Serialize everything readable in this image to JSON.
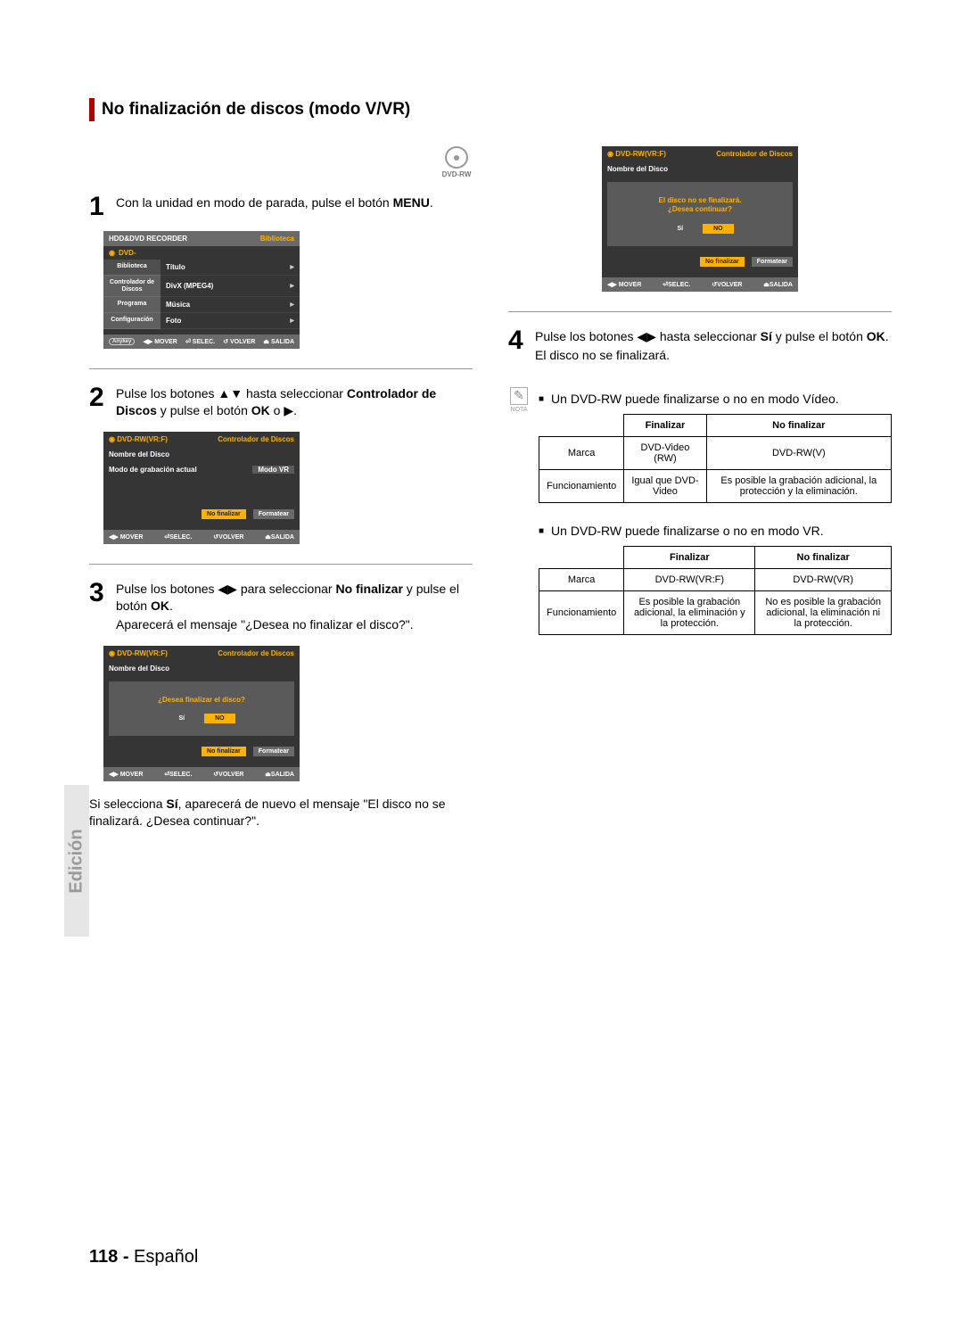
{
  "title": "No finalización de discos (modo V/VR)",
  "disc_label": "DVD-RW",
  "steps": {
    "s1": {
      "num": "1",
      "text_a": "Con la unidad en modo de parada, pulse el botón ",
      "b": "MENU",
      "text_b": "."
    },
    "s2": {
      "num": "2",
      "text_a": "Pulse los botones ▲▼ hasta seleccionar ",
      "b": "Controlador de Discos",
      "text_b": " y pulse el botón ",
      "b2": "OK",
      "text_c": " o ▶."
    },
    "s3": {
      "num": "3",
      "text_a": "Pulse los botones ◀▶ para seleccionar ",
      "b": "No finalizar",
      "text_b": " y pulse el botón ",
      "b2": "OK",
      "text_c": ".",
      "follow": "Aparecerá el mensaje \"¿Desea no finalizar el disco?\"."
    },
    "s3b": {
      "pre": "Si selecciona ",
      "b": "Sí",
      "post": ", aparecerá de nuevo el mensaje \"El disco no se finalizará. ¿Desea continuar?\"."
    },
    "s4": {
      "num": "4",
      "text_a": "Pulse los botones ◀▶ hasta seleccionar ",
      "b": "Sí",
      "text_b": " y pulse el botón ",
      "b2": "OK",
      "text_c": ".",
      "follow": "El disco no se finalizará."
    }
  },
  "note": {
    "label": "NOTA",
    "text1": "Un DVD-RW puede finalizarse o no en modo Vídeo.",
    "text2": "Un DVD-RW puede finalizarse o no en modo VR."
  },
  "table1": {
    "h1": "Finalizar",
    "h2": "No finalizar",
    "r1c0": "Marca",
    "r1c1": "DVD-Video (RW)",
    "r1c2": "DVD-RW(V)",
    "r2c0": "Funcionamiento",
    "r2c1": "Igual que DVD-Video",
    "r2c2": "Es posible la grabación adicional, la protección y la eliminación."
  },
  "table2": {
    "h1": "Finalizar",
    "h2": "No finalizar",
    "r1c0": "Marca",
    "r1c1": "DVD-RW(VR:F)",
    "r1c2": "DVD-RW(VR)",
    "r2c0": "Funcionamiento",
    "r2c1": "Es posible la grabación adicional, la eliminación y la protección.",
    "r2c2": "No es posible la grabación adicional, la eliminación ni la protección."
  },
  "osd1": {
    "head_l": "HDD&DVD RECORDER",
    "head_r": "Biblioteca",
    "sub": "DVD-",
    "side": [
      "Biblioteca",
      "Controlador de Discos",
      "Programa",
      "Configuración"
    ],
    "items": [
      "Título",
      "DivX (MPEG4)",
      "Música",
      "Foto"
    ]
  },
  "osd2": {
    "head_l": "DVD-RW(VR:F)",
    "head_r": "Controlador de Discos",
    "line1": "Nombre del Disco",
    "line2_l": "Modo de grabación actual",
    "line2_r": "Modo VR",
    "btn1": "No finalizar",
    "btn2": "Formatear"
  },
  "osd3": {
    "head_l": "DVD-RW(VR:F)",
    "head_r": "Controlador de Discos",
    "line1": "Nombre del Disco",
    "question": "¿Desea finalizar el disco?",
    "yes": "Sí",
    "no": "NO",
    "btn1": "No finalizar",
    "btn2": "Formatear"
  },
  "osd4": {
    "head_l": "DVD-RW(VR:F)",
    "head_r": "Controlador de Discos",
    "line1": "Nombre del Disco",
    "q1": "El disco no se finalizará.",
    "q2": "¿Desea continuar?",
    "yes": "Sí",
    "no": "NO",
    "btn1": "No finalizar",
    "btn2": "Formatear"
  },
  "footbar": {
    "a": "MOVER",
    "b": "SELEC.",
    "c": "VOLVER",
    "d": "SALIDA"
  },
  "side_tab": "Edición",
  "footer": {
    "page": "118 - ",
    "lang": "Español"
  }
}
